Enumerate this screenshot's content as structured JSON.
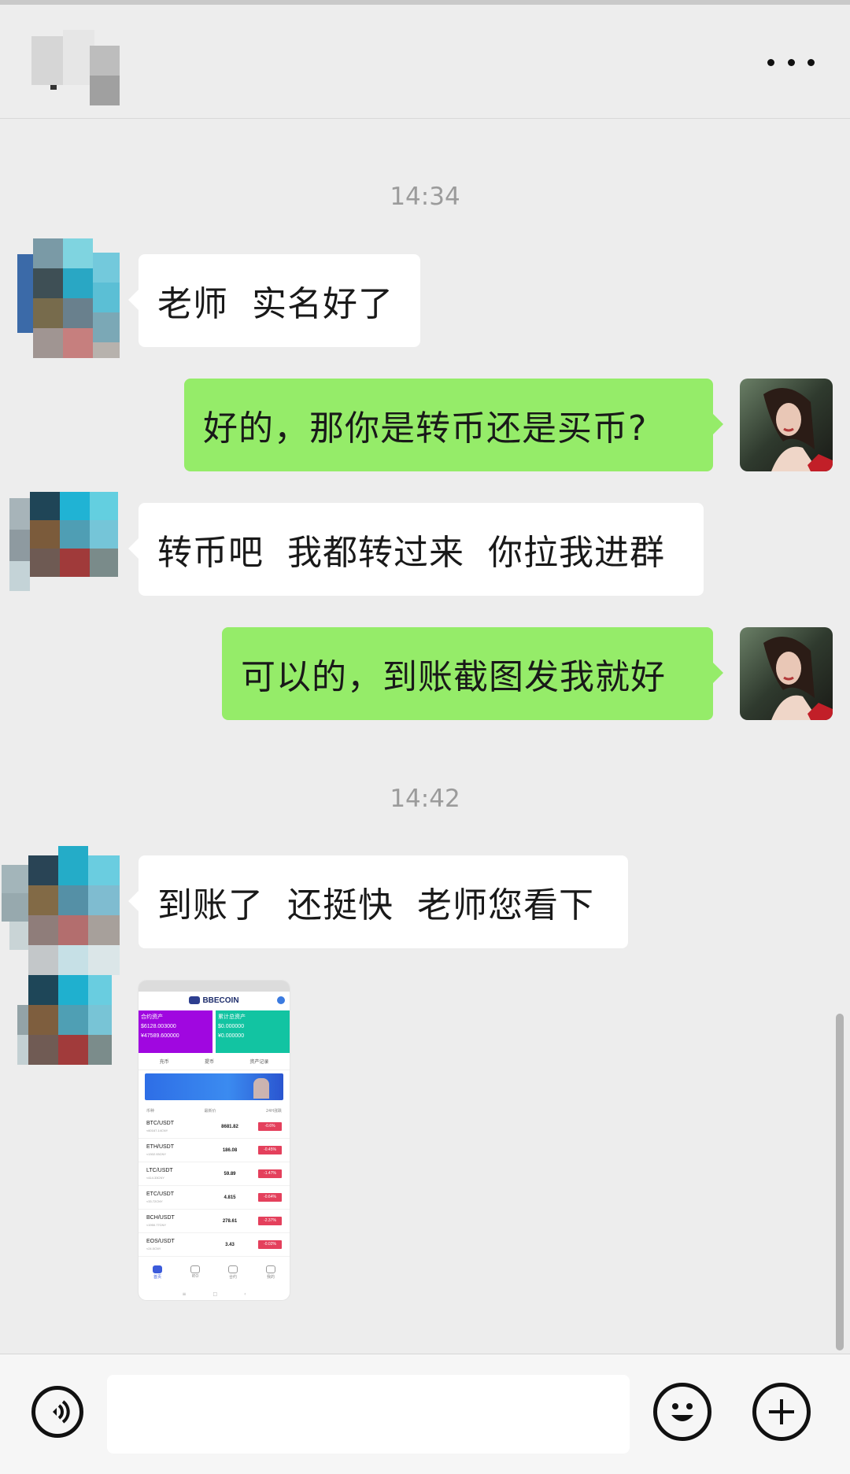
{
  "header": {
    "contact_name_mosaic": [
      {
        "c": "#c2c2c2"
      },
      {
        "c": "#d8d8d8"
      },
      {
        "c": "#a9a9a9"
      },
      {
        "c": "#e2e2e2"
      }
    ],
    "more_icon": "more-dots-icon"
  },
  "chat": {
    "timestamps": [
      "14:34",
      "14:42"
    ],
    "messages": [
      {
        "side": "left",
        "text": "老师  实名好了"
      },
      {
        "side": "right",
        "text": "好的，那你是转币还是买币?"
      },
      {
        "side": "left",
        "text": "转币吧  我都转过来  你拉我进群"
      },
      {
        "side": "right",
        "text": "可以的，到账截图发我就好"
      },
      {
        "side": "left",
        "text": "到账了  还挺快  老师您看下"
      }
    ],
    "image_message": {
      "brand": "BBECOIN",
      "cards": [
        {
          "title": "合约资产",
          "value": "$6128.003000",
          "sub": "¥47589.600000"
        },
        {
          "title": "累计总资产",
          "value": "$0.000000",
          "sub": "¥0.000000"
        }
      ],
      "quick_links": [
        "充币",
        "提币",
        "资产记录"
      ],
      "table_headers": [
        "币种",
        "最新价",
        "24H涨跌"
      ],
      "rows": [
        {
          "pair": "BTC/USDT",
          "cny": "≈60167.14CNY",
          "price": "8681.82",
          "change": "-0.6%"
        },
        {
          "pair": "ETH/USDT",
          "cny": "≈1302.93CNY",
          "price": "186.08",
          "change": "-0.45%"
        },
        {
          "pair": "LTC/USDT",
          "cny": "≈414.33CNY",
          "price": "59.89",
          "change": "-1.47%"
        },
        {
          "pair": "ETC/USDT",
          "cny": "≈33.72CNY",
          "price": "4.815",
          "change": "-0.64%"
        },
        {
          "pair": "BCH/USDT",
          "cny": "≈1950.77CNY",
          "price": "278.61",
          "change": "-2.37%"
        },
        {
          "pair": "EOS/USDT",
          "cny": "≈24.0CNY",
          "price": "3.43",
          "change": "-0.02%"
        }
      ],
      "tabs": [
        "首页",
        "IEO",
        "合约",
        "我的"
      ],
      "nav": [
        "≡",
        "□",
        "‹"
      ]
    }
  },
  "input_bar": {
    "voice_icon": "voice-icon",
    "emoji_icon": "emoji-icon",
    "plus_icon": "plus-icon",
    "input_value": ""
  },
  "colors": {
    "background": "#ededed",
    "sent_bubble": "#95ec69",
    "received_bubble": "#ffffff"
  }
}
